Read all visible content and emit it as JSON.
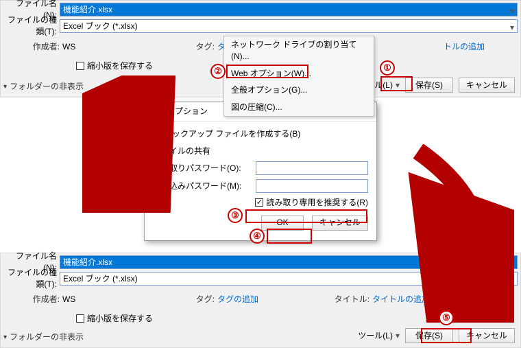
{
  "filename_label": "ファイル名(N):",
  "filetype_label": "ファイルの種類(T):",
  "filename_label2": "ファイル名(N):",
  "filetype_label2": "ファイルの種類(T):",
  "filename_value": "機能紹介.xlsx",
  "filetype_value": "Excel ブック (*.xlsx)",
  "author_label": "作成者:",
  "author_value": "WS",
  "tag_label": "タグ:",
  "tag_value_partial": "タ",
  "tag_value_full": "タグの追加",
  "title_label": "タイトル:",
  "title_value": "トルの追加",
  "title_value_full": "タイトルの追加",
  "thumb_chk": "縮小版を保存する",
  "folders_toggle": "フォルダーの非表示",
  "tools_btn": "ツール(L)",
  "save_btn": "保存(S)",
  "cancel_btn": "キャンセル",
  "menu": {
    "net": "ネットワーク ドライブの割り当て(N)...",
    "web": "Web オプション(W)...",
    "gen": "全般オプション(G)...",
    "pic": "図の圧縮(C)..."
  },
  "dialog": {
    "title": "全般オプション",
    "backup": "バックアップ ファイルを作成する(B)",
    "share": "ファイルの共有",
    "readpw": "読み取りパスワード(O):",
    "writepw": "書き込みパスワード(M):",
    "rorec": "読み取り専用を推奨する(R)",
    "ok": "OK",
    "cancel": "キャンセル"
  },
  "nums": {
    "n1": "①",
    "n2": "②",
    "n3": "③",
    "n4": "④",
    "n5": "⑤"
  }
}
